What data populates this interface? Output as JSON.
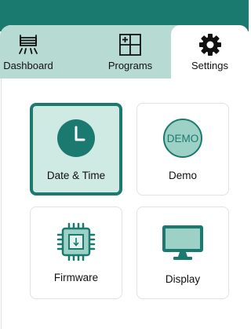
{
  "colors": {
    "primary": "#1a7a6f",
    "tab_background": "#b7dbd2",
    "selected_card_background": "#cfe9e3",
    "demo_badge_fill": "#9ed1c6"
  },
  "tabs": [
    {
      "label": "Dashboard",
      "icon": "heater-icon",
      "active": false
    },
    {
      "label": "Programs",
      "icon": "grid-plus-icon",
      "active": false
    },
    {
      "label": "Settings",
      "icon": "gear-icon",
      "active": true
    }
  ],
  "settings": {
    "cards": [
      {
        "label": "Date & Time",
        "icon": "clock-icon",
        "selected": true
      },
      {
        "label": "Demo",
        "icon": "demo-badge-icon",
        "badge_text": "DEMO",
        "selected": false
      },
      {
        "label": "Firmware",
        "icon": "chip-icon",
        "selected": false
      },
      {
        "label": "Display",
        "icon": "monitor-icon",
        "selected": false
      }
    ]
  }
}
